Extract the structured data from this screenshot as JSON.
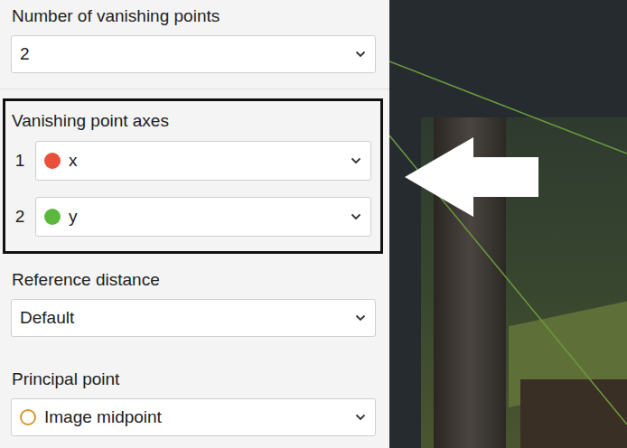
{
  "vanishing_count": {
    "label": "Number of vanishing points",
    "value": "2"
  },
  "axes": {
    "label": "Vanishing point axes",
    "highlighted": true,
    "rows": [
      {
        "index": "1",
        "value": "x",
        "color": "#e8503a"
      },
      {
        "index": "2",
        "value": "y",
        "color": "#5cb83c"
      }
    ]
  },
  "reference_distance": {
    "label": "Reference distance",
    "value": "Default"
  },
  "principal_point": {
    "label": "Principal point",
    "value": "Image midpoint",
    "color": "#d89a2c"
  }
}
